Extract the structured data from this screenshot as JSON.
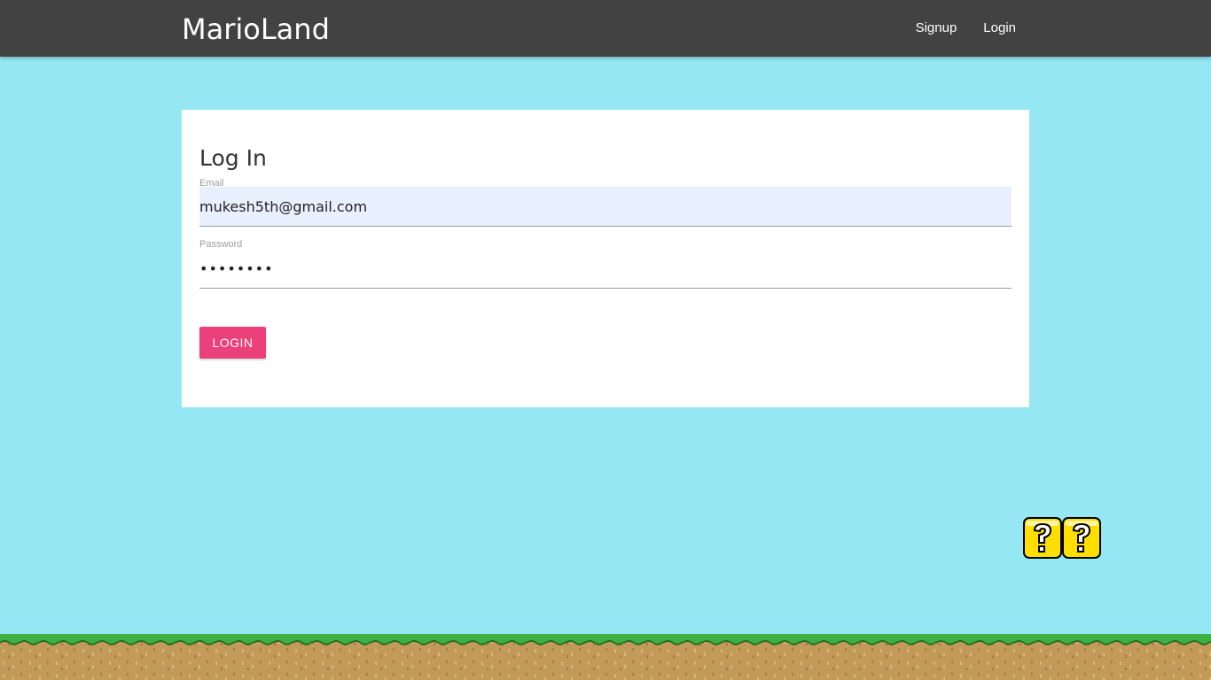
{
  "header": {
    "brand": "MarioLand",
    "nav": [
      {
        "label": "Signup"
      },
      {
        "label": "Login"
      }
    ]
  },
  "login_card": {
    "title": "Log In",
    "email": {
      "label": "Email",
      "value": "mukesh5th@gmail.com"
    },
    "password": {
      "label": "Password",
      "masked_value": "••••••••"
    },
    "submit_label": "LOGIN"
  },
  "decor": {
    "question_block_icon": "question-block-icon",
    "ground_icon": "grass-ground"
  },
  "colors": {
    "sky": "#95e7f3",
    "navbar": "#424242",
    "accent": "#ec407a",
    "autofill": "#e8f0fe",
    "block": "#ffde00",
    "grass": "#3cb043",
    "dirt": "#c49a58"
  }
}
